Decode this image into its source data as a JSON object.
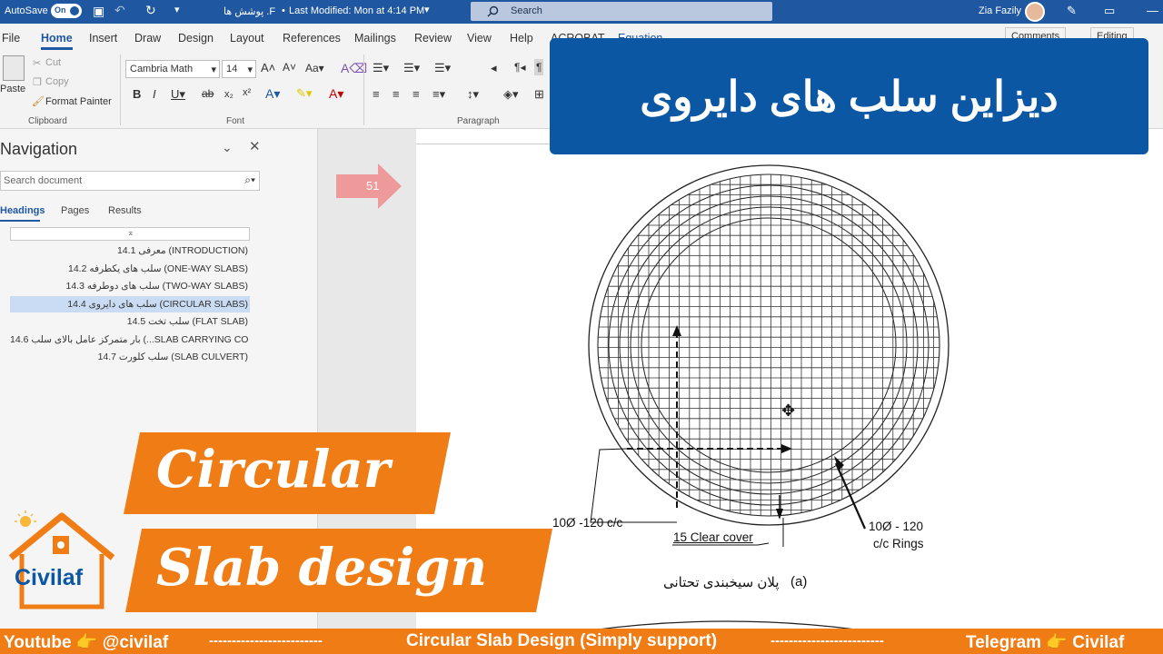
{
  "titlebar": {
    "autosave_label": "AutoSave",
    "autosave_state": "On",
    "document_title": "پوشش ها .F",
    "last_modified": "Last Modified: Mon at 4:14 PM",
    "search_placeholder": "Search",
    "user_name": "Zia Fazily"
  },
  "ribbon_tabs": [
    "File",
    "Home",
    "Insert",
    "Draw",
    "Design",
    "Layout",
    "References",
    "Mailings",
    "Review",
    "View",
    "Help",
    "ACROBAT",
    "Equation"
  ],
  "ribbon_right": {
    "comments": "Comments",
    "editing": "Editing"
  },
  "ribbon": {
    "clipboard": {
      "paste": "Paste",
      "cut": "Cut",
      "copy": "Copy",
      "format_painter": "Format Painter",
      "group": "Clipboard"
    },
    "font": {
      "name": "Cambria Math",
      "size": "14",
      "group": "Font"
    },
    "paragraph": {
      "group": "Paragraph"
    }
  },
  "navigation": {
    "title": "Navigation",
    "search_placeholder": "Search document",
    "tabs": [
      "Headings",
      "Pages",
      "Results"
    ],
    "headings": [
      "14.1 معرفی (INTRODUCTION)",
      "14.2 سلب های یکطرفه (ONE-WAY SLABS)",
      "14.3 سلب های دوطرفه (TWO-WAY SLABS)",
      "14.4 سلب های دایروی (CIRCULAR SLABS)",
      "14.5 سلب تخت (FLAT SLAB)",
      "14.6 بار متمرکز عامل بالای سلب (...SLAB CARRYING CO",
      "14.7 سلب کلورت (SLAB CULVERT)"
    ],
    "selected_index": 3
  },
  "document": {
    "page_badge": "51",
    "drawing_labels": {
      "bars": "10Ø -120 c/c",
      "cover": "15 Clear cover",
      "rings_line1": "10Ø - 120",
      "rings_line2": "c/c Rings",
      "caption": "پلان سیخبندی تحتانی",
      "caption_letter": "(a)"
    }
  },
  "overlays": {
    "persian_title": "دیزاین سلب های دایروی",
    "english_line1": "Circular",
    "english_line2": "Slab design",
    "brand": "Civilaf",
    "bottom_bar": {
      "left": "Youtube 👉 @civilaf",
      "dash1": "-------------------------",
      "center": "Circular Slab Design (Simply support)",
      "dash2": "-------------------------",
      "right": "Telegram 👉 Civilaf"
    }
  },
  "colors": {
    "word_blue": "#1f57a0",
    "banner_blue": "#0b57a4",
    "orange": "#f07c16"
  }
}
